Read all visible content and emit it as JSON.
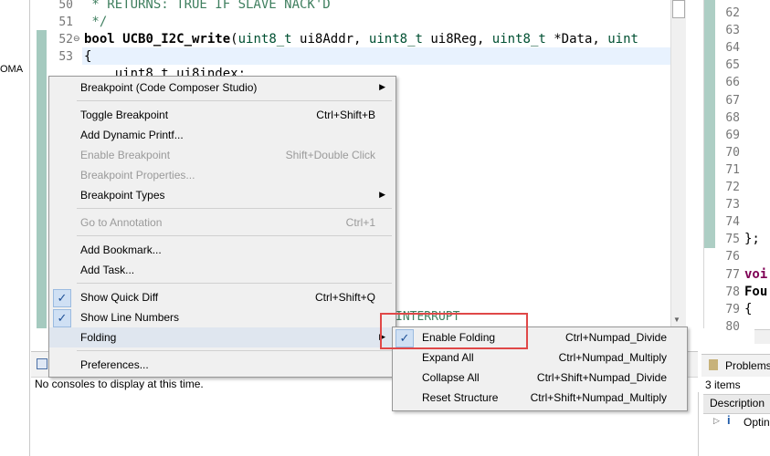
{
  "left_strip": {
    "cut_label": "OMA"
  },
  "editor": {
    "lines": [
      {
        "num": "50",
        "segments": [
          {
            "text": " * RETURNS: TRUE IF SLAVE NACK'D",
            "cls": "cmt"
          }
        ]
      },
      {
        "num": "51",
        "segments": [
          {
            "text": " */",
            "cls": "cmt"
          }
        ]
      },
      {
        "num": "52",
        "segments": [
          {
            "text": "bool ",
            "cls": "kw"
          },
          {
            "text": "UCB0_I2C_write",
            "cls": "fn"
          },
          {
            "text": "(",
            "cls": ""
          },
          {
            "text": "uint8_t",
            "cls": "ty"
          },
          {
            "text": " ui8Addr, ",
            "cls": ""
          },
          {
            "text": "uint8_t",
            "cls": "ty"
          },
          {
            "text": " ui8Reg, ",
            "cls": ""
          },
          {
            "text": "uint8_t",
            "cls": "ty"
          },
          {
            "text": " *Data, ",
            "cls": ""
          },
          {
            "text": "uint",
            "cls": "ty"
          }
        ]
      },
      {
        "num": "53",
        "segments": [
          {
            "text": "{",
            "cls": ""
          }
        ]
      },
      {
        "num": "",
        "segments": [
          {
            "text": "    uint8_t ui8index;",
            "cls": ""
          }
        ]
      }
    ]
  },
  "right_pane": {
    "lines": [
      {
        "num": "62",
        "code": ""
      },
      {
        "num": "63",
        "code": ""
      },
      {
        "num": "64",
        "code": ""
      },
      {
        "num": "65",
        "code": ""
      },
      {
        "num": "66",
        "code": ""
      },
      {
        "num": "67",
        "code": ""
      },
      {
        "num": "68",
        "code": ""
      },
      {
        "num": "69",
        "code": ""
      },
      {
        "num": "70",
        "code": ""
      },
      {
        "num": "71",
        "code": ""
      },
      {
        "num": "72",
        "code": ""
      },
      {
        "num": "73",
        "code": ""
      },
      {
        "num": "74",
        "code": ""
      },
      {
        "num": "75",
        "code": "};"
      },
      {
        "num": "76",
        "code": ""
      },
      {
        "num": "77",
        "code": "voi"
      },
      {
        "num": "78",
        "code": "Fou"
      },
      {
        "num": "79",
        "code": "{"
      },
      {
        "num": "80",
        "code": ""
      }
    ]
  },
  "console": {
    "message": "No consoles to display at this time."
  },
  "problems": {
    "title": "Problems",
    "count": "3 items",
    "column": "Description",
    "row_text": "Optin"
  },
  "context_menu": {
    "items": [
      {
        "label": "Breakpoint (Code Composer Studio)",
        "accel": "",
        "submenu": true,
        "disabled": false,
        "checked": false
      },
      {
        "sep": true
      },
      {
        "label": "Toggle Breakpoint",
        "accel": "Ctrl+Shift+B",
        "submenu": false,
        "disabled": false,
        "checked": false
      },
      {
        "label": "Add Dynamic Printf...",
        "accel": "",
        "submenu": false,
        "disabled": false,
        "checked": false
      },
      {
        "label": "Enable Breakpoint",
        "accel": "Shift+Double Click",
        "submenu": false,
        "disabled": true,
        "checked": false
      },
      {
        "label": "Breakpoint Properties...",
        "accel": "",
        "submenu": false,
        "disabled": true,
        "checked": false
      },
      {
        "label": "Breakpoint Types",
        "accel": "",
        "submenu": true,
        "disabled": false,
        "checked": false
      },
      {
        "sep": true
      },
      {
        "label": "Go to Annotation",
        "accel": "Ctrl+1",
        "submenu": false,
        "disabled": true,
        "checked": false
      },
      {
        "sep": true
      },
      {
        "label": "Add Bookmark...",
        "accel": "",
        "submenu": false,
        "disabled": false,
        "checked": false
      },
      {
        "label": "Add Task...",
        "accel": "",
        "submenu": false,
        "disabled": false,
        "checked": false
      },
      {
        "sep": true
      },
      {
        "label": "Show Quick Diff",
        "accel": "Ctrl+Shift+Q",
        "submenu": false,
        "disabled": false,
        "checked": true
      },
      {
        "label": "Show Line Numbers",
        "accel": "",
        "submenu": false,
        "disabled": false,
        "checked": true
      },
      {
        "label": "Folding",
        "accel": "",
        "submenu": true,
        "disabled": false,
        "checked": false,
        "hover": true
      },
      {
        "sep": true
      },
      {
        "label": "Preferences...",
        "accel": "",
        "submenu": false,
        "disabled": false,
        "checked": false
      }
    ]
  },
  "folding_submenu": {
    "items": [
      {
        "label": "Enable Folding",
        "accel": "Ctrl+Numpad_Divide",
        "checked": true
      },
      {
        "label": "Expand All",
        "accel": "Ctrl+Numpad_Multiply",
        "checked": false
      },
      {
        "label": "Collapse All",
        "accel": "Ctrl+Shift+Numpad_Divide",
        "checked": false
      },
      {
        "label": "Reset Structure",
        "accel": "Ctrl+Shift+Numpad_Multiply",
        "checked": false
      }
    ]
  },
  "background_text": {
    "interrupt": "INTERRUPT"
  },
  "icons": {
    "checkmark": "✓",
    "submenu_arrow": "▶"
  }
}
